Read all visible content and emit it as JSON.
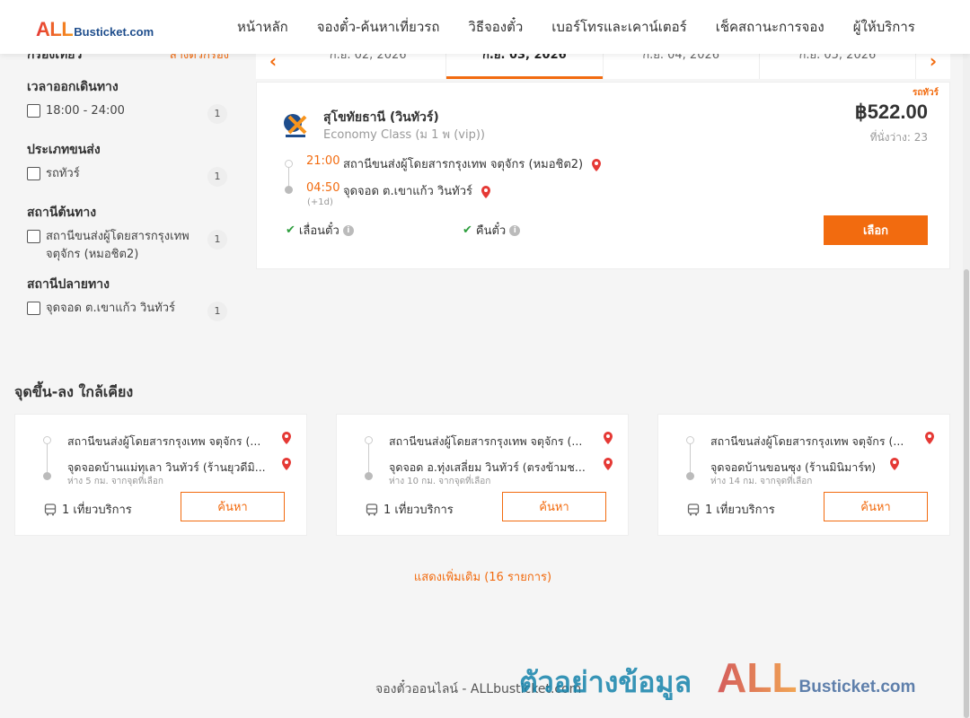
{
  "header": {
    "logo_all": "ALL",
    "logo_rest": "Busticket.com",
    "nav": [
      "หน้าหลัก",
      "จองตั๋ว-ค้นหาเที่ยวรถ",
      "วิธีจองตั๋ว",
      "เบอร์โทรและเคาน์เตอร์",
      "เช็คสถานะการจอง",
      "ผู้ให้บริการ"
    ]
  },
  "filters": {
    "title": "กรองเที่ยว",
    "clear": "ล้างตัวกรอง",
    "groups": [
      {
        "title": "เวลาออกเดินทาง",
        "option": "18:00 - 24:00",
        "count": "1"
      },
      {
        "title": "ประเภทขนส่ง",
        "option": "รถทัวร์",
        "count": "1"
      },
      {
        "title": "สถานีต้นทาง",
        "option": "สถานีขนส่งผู้โดยสารกรุงเทพ จตุจักร (หมอชิต2)",
        "count": "1"
      },
      {
        "title": "สถานีปลายทาง",
        "option": "จุดจอด ต.เขาแก้ว วินทัวร์",
        "count": "1"
      }
    ]
  },
  "dates": {
    "tabs": [
      "ก.ย. 02, 2026",
      "ก.ย. 03, 2026",
      "ก.ย. 04, 2026",
      "ก.ย. 05, 2026"
    ],
    "active": "ก.ย. 03, 2026"
  },
  "trip": {
    "tag": "รถทัวร์",
    "operator": "สุโขทัยธานี (วินทัวร์)",
    "class": "Economy Class (ม 1 พ (vip))",
    "price": "฿522.00",
    "seats": "ที่นั่งว่าง: 23",
    "dep_time": "21:00",
    "dep_stop": "สถานีขนส่งผู้โดยสารกรุงเทพ จตุจักร (หมอชิต2)",
    "arr_time": "04:50",
    "arr_stop": "จุดจอด ต.เขาแก้ว วินทัวร์",
    "next_day": "(+1d)",
    "feature_1": "เลื่อนตั๋ว",
    "feature_2": "คืนตั๋ว",
    "select": "เลือก"
  },
  "nearby": {
    "title": "จุดขึ้น-ลง ใกล้เคียง",
    "cards": [
      {
        "from": "สถานีขนส่งผู้โดยสารกรุงเทพ จตุจักร (...",
        "to": "จุดจอดบ้านแม่ทุเลา วินทัวร์ (ร้านยุวดีมิ...",
        "distance": "ห่าง 5 กม. จากจุดที่เลือก",
        "service": "1 เที่ยวบริการ",
        "button": "ค้นหา"
      },
      {
        "from": "สถานีขนส่งผู้โดยสารกรุงเทพ จตุจักร (...",
        "to": "จุดจอด อ.ทุ่งเสลี่ยม วินทัวร์ (ตรงข้ามช...",
        "distance": "ห่าง 10 กม. จากจุดที่เลือก",
        "service": "1 เที่ยวบริการ",
        "button": "ค้นหา"
      },
      {
        "from": "สถานีขนส่งผู้โดยสารกรุงเทพ จตุจักร (...",
        "to": "จุดจอดบ้านขอนซุง (ร้านมินิมาร์ท)",
        "distance": "ห่าง 14 กม. จากจุดที่เลือก",
        "service": "1 เที่ยวบริการ",
        "button": "ค้นหา"
      }
    ],
    "more": "แสดงเพิ่มเติม (16 รายการ)"
  },
  "footer": "จองตั๋วออนไลน์ - ALLbusticket.com",
  "watermark": {
    "thai": "ตัวอย่างข้อมูล",
    "all": "ALL",
    "rest": "Busticket.com"
  },
  "colors": {
    "accent": "#f26b0f",
    "pin": "#e53935",
    "check": "#2e9e3e"
  }
}
